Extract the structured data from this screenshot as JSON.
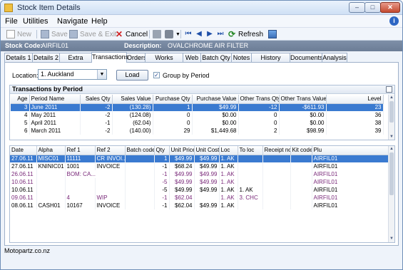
{
  "window": {
    "title": "Stock Item Details"
  },
  "menu": [
    "File",
    "Utilities",
    "Navigate",
    "Help"
  ],
  "toolbar": {
    "new_label": "New",
    "save_label": "Save",
    "save_exit_label": "Save & Exit",
    "cancel_label": "Cancel",
    "refresh_label": "Refresh"
  },
  "stock": {
    "code_label": "Stock Code:",
    "code_value": "AIRFIL01",
    "desc_label": "Description:",
    "desc_value": "OVALCHROME AIR FILTER"
  },
  "tabs": [
    "Details 1",
    "Details 2",
    "Extra Fields",
    "Transactions",
    "Orders",
    "Works Orders",
    "Web",
    "Batch Qty",
    "Notes",
    "History Notes",
    "Documents",
    "Analysis"
  ],
  "active_tab": "Transactions",
  "filters": {
    "location_label": "Location:",
    "location_value": "1. Auckland",
    "load_label": "Load",
    "group_label": "Group by Period",
    "group_checked": true
  },
  "periods": {
    "title": "Transactions by Period",
    "columns": [
      "Age",
      "Period Name",
      "Sales Qty",
      "Sales Value",
      "Purchase Qty",
      "Purchase Value",
      "Other Trans Qty",
      "Other Trans Value",
      "Level"
    ],
    "rows": [
      [
        "3",
        "June 2011",
        "-2",
        "(130.28)",
        "1",
        "$49.99",
        "-12",
        "-$611.93",
        "23"
      ],
      [
        "4",
        "May 2011",
        "-2",
        "(124.08)",
        "0",
        "$0.00",
        "0",
        "$0.00",
        "36"
      ],
      [
        "5",
        "April 2011",
        "-1",
        "(62.04)",
        "0",
        "$0.00",
        "0",
        "$0.00",
        "38"
      ],
      [
        "6",
        "March 2011",
        "-2",
        "(140.00)",
        "29",
        "$1,449.68",
        "2",
        "$98.99",
        "39"
      ]
    ]
  },
  "transactions": {
    "columns": [
      "Date",
      "Alpha",
      "Ref 1",
      "Ref 2",
      "Batch code",
      "Qty",
      "Unit Price",
      "Unit Cost",
      "Loc",
      "To loc",
      "Receipt no",
      "Kit code",
      "Plu"
    ],
    "rows": [
      [
        "27.06.11",
        "MISC01",
        "11111",
        "CR INVOI...",
        "",
        "1",
        "$49.99",
        "$49.99",
        "1. AK",
        "",
        "",
        "",
        "AIRFIL01"
      ],
      [
        "27.06.11",
        "KNINIC01",
        "1001",
        "INVOICE",
        "",
        "-1",
        "$68.24",
        "$49.99",
        "1. AK",
        "",
        "",
        "",
        "AIRFIL01"
      ],
      [
        "26.06.11",
        "",
        "BOM: CA...",
        "",
        "",
        "-1",
        "$49.99",
        "$49.99",
        "1. AK",
        "",
        "",
        "",
        "AIRFIL01"
      ],
      [
        "10.06.11",
        "",
        "",
        "",
        "",
        "-5",
        "$49.99",
        "$49.99",
        "1. AK",
        "",
        "",
        "",
        "AIRFIL01"
      ],
      [
        "10.06.11",
        "",
        "",
        "",
        "",
        "-5",
        "$49.99",
        "$49.99",
        "1. AK",
        "1. AK",
        "",
        "",
        "AIRFIL01"
      ],
      [
        "09.06.11",
        "",
        "4",
        "WIP",
        "",
        "-1",
        "$62.04",
        "",
        "1. AK",
        "3. CHC",
        "",
        "",
        "AIRFIL01"
      ],
      [
        "08.06.11",
        "CASH01",
        "10167",
        "INVOICE",
        "",
        "-1",
        "$62.04",
        "$49.99",
        "1. AK",
        "",
        "",
        "",
        "AIRFIL01"
      ]
    ]
  },
  "status": {
    "text": "Motopartz.co.nz"
  },
  "colors": {
    "selection": "#3a7ad0",
    "stockbar": "#6c7d96",
    "purple_row": "#7a2a7a"
  }
}
